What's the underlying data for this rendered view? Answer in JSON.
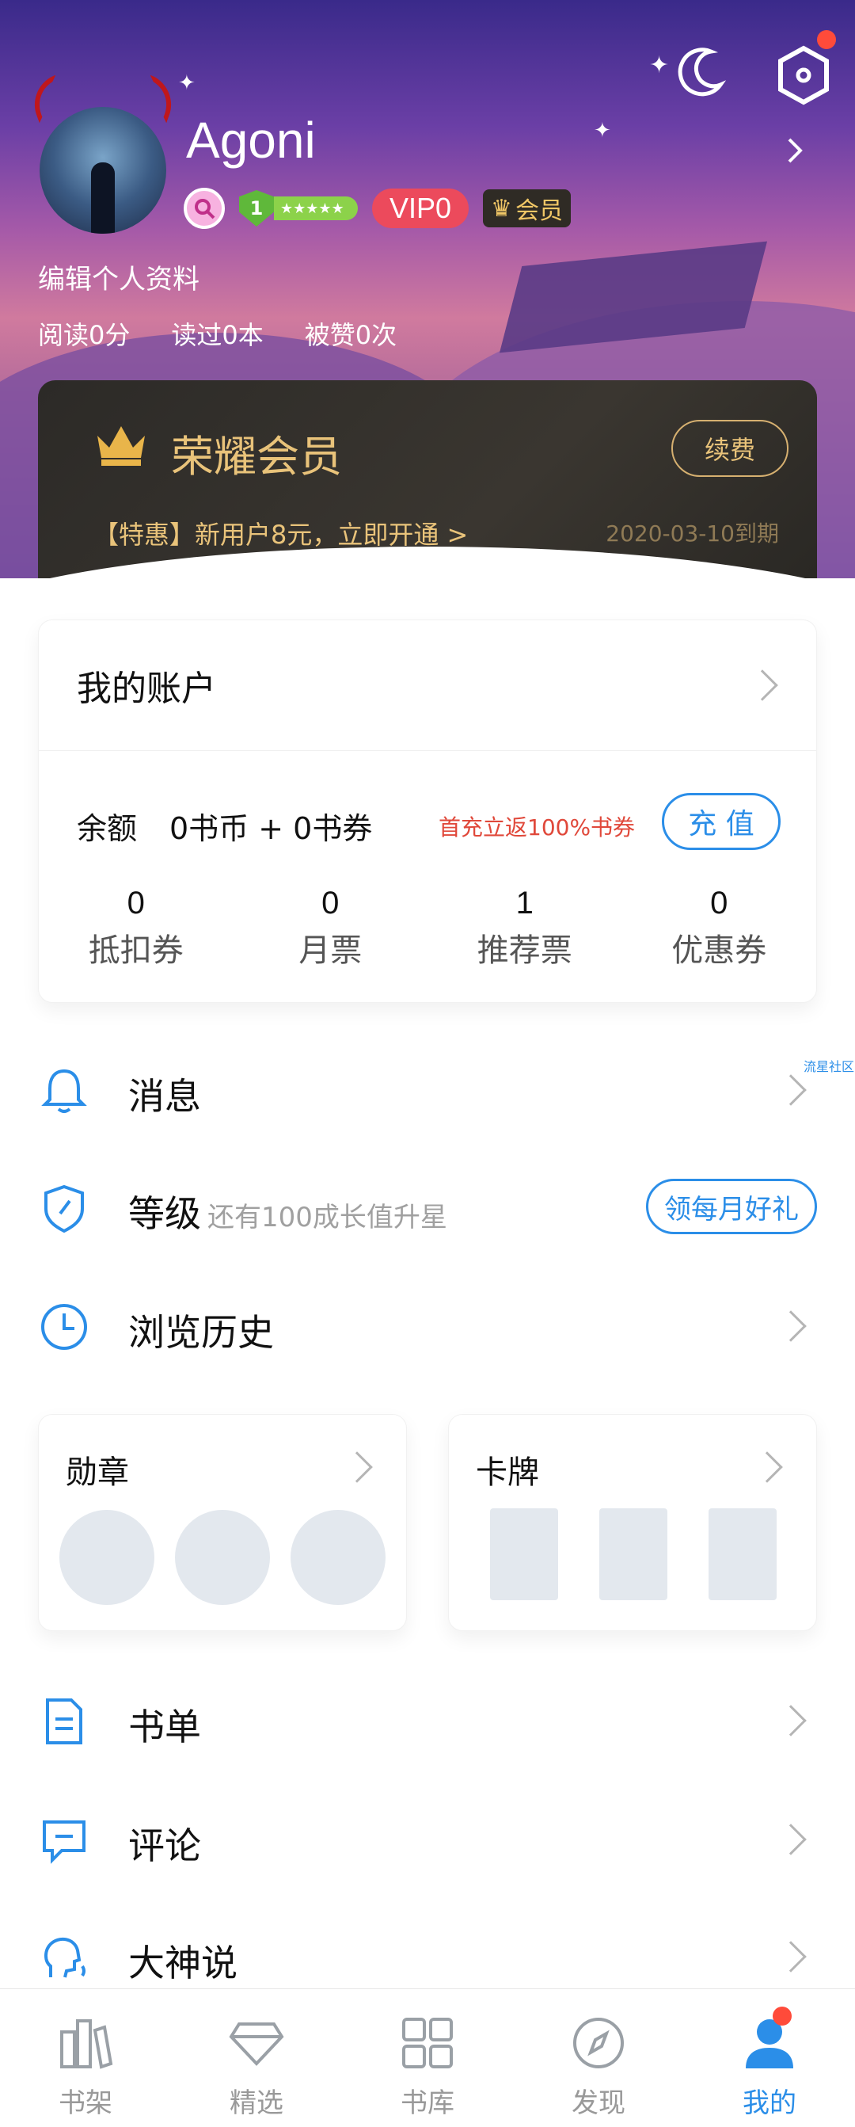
{
  "colors": {
    "accent": "#2b8ee8",
    "vip_gold": "#e9c37a",
    "promo_red": "#e0483a",
    "notification_dot": "#ff4b3a"
  },
  "profile": {
    "username": "Agoni",
    "level": "1",
    "level_stars": "★★★★★",
    "vip_label": "VIP0",
    "member_badge": "会员",
    "edit_label": "编辑个人资料",
    "stats": {
      "reading": "阅读0分",
      "read_books": "读过0本",
      "liked": "被赞0次"
    }
  },
  "vip_card": {
    "title": "荣耀会员",
    "renew_label": "续费",
    "promo": "【特惠】新用户8元，立即开通 >",
    "expire": "2020-03-10到期"
  },
  "account": {
    "title": "我的账户",
    "balance_label": "余额",
    "balance_value": "0书币 + 0书券",
    "promo": "首充立返100%书券",
    "recharge_label": "充 值",
    "coupons": [
      {
        "num": "0",
        "label": "抵扣券"
      },
      {
        "num": "0",
        "label": "月票"
      },
      {
        "num": "1",
        "label": "推荐票"
      },
      {
        "num": "0",
        "label": "优惠券"
      }
    ]
  },
  "menu": {
    "messages": "消息",
    "level": "等级",
    "level_sub": "还有100成长值升星",
    "gift_label": "领每月好礼",
    "history": "浏览历史",
    "booklist": "书单",
    "comments": "评论",
    "masters": "大神说"
  },
  "community_tag": "流星社区",
  "boxes": {
    "medals": "勋章",
    "cards": "卡牌"
  },
  "nav": [
    {
      "label": "书架",
      "icon": "bookshelf-icon"
    },
    {
      "label": "精选",
      "icon": "diamond-icon"
    },
    {
      "label": "书库",
      "icon": "grid-icon"
    },
    {
      "label": "发现",
      "icon": "compass-icon"
    },
    {
      "label": "我的",
      "icon": "user-icon",
      "active": true
    }
  ]
}
